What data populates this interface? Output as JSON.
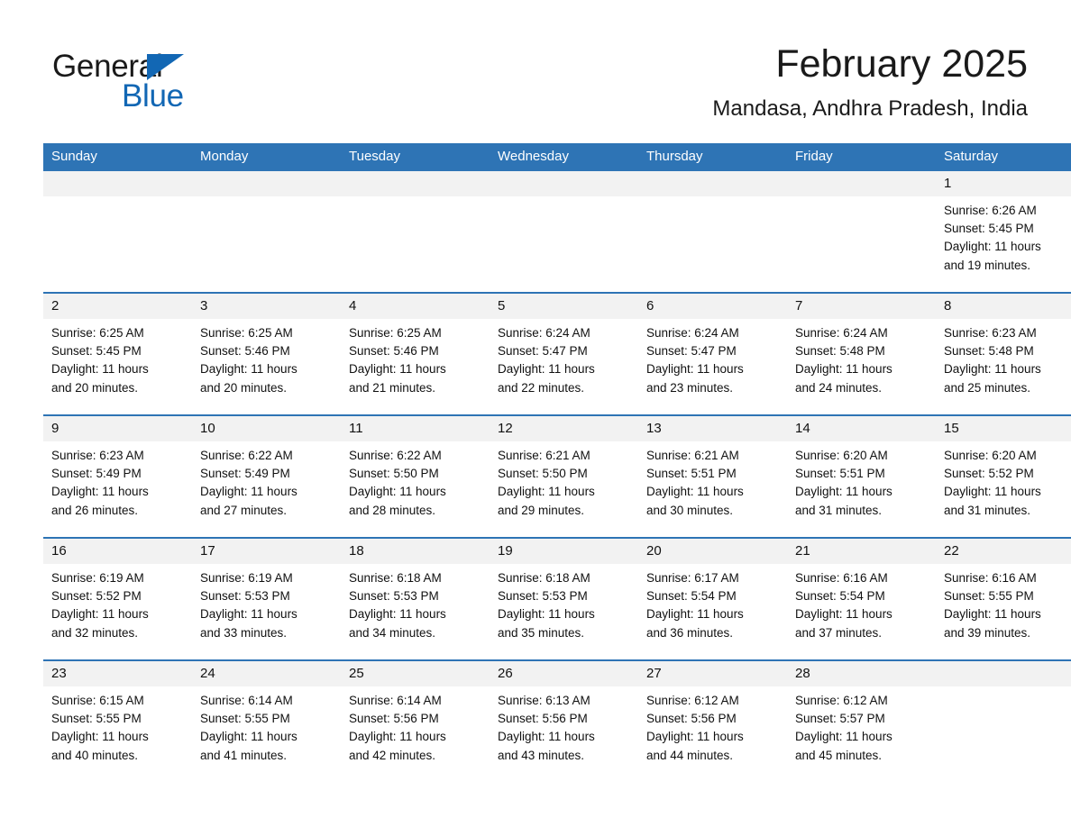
{
  "brand": {
    "name_part1": "General",
    "name_part2": "Blue",
    "accent_color": "#1267b4"
  },
  "header": {
    "title": "February 2025",
    "subtitle": "Mandasa, Andhra Pradesh, India",
    "header_bg_color": "#2e74b5",
    "daynum_bg_color": "#f2f2f2"
  },
  "weekday_headers": [
    "Sunday",
    "Monday",
    "Tuesday",
    "Wednesday",
    "Thursday",
    "Friday",
    "Saturday"
  ],
  "labels": {
    "sunrise_prefix": "Sunrise: ",
    "sunset_prefix": "Sunset: ",
    "daylight_prefix": "Daylight: "
  },
  "weeks": [
    [
      {
        "day": "",
        "blank": true
      },
      {
        "day": "",
        "blank": true
      },
      {
        "day": "",
        "blank": true
      },
      {
        "day": "",
        "blank": true
      },
      {
        "day": "",
        "blank": true
      },
      {
        "day": "",
        "blank": true
      },
      {
        "day": "1",
        "sunrise": "Sunrise: 6:26 AM",
        "sunset": "Sunset: 5:45 PM",
        "daylight_line1": "Daylight: 11 hours",
        "daylight_line2": "and 19 minutes."
      }
    ],
    [
      {
        "day": "2",
        "sunrise": "Sunrise: 6:25 AM",
        "sunset": "Sunset: 5:45 PM",
        "daylight_line1": "Daylight: 11 hours",
        "daylight_line2": "and 20 minutes."
      },
      {
        "day": "3",
        "sunrise": "Sunrise: 6:25 AM",
        "sunset": "Sunset: 5:46 PM",
        "daylight_line1": "Daylight: 11 hours",
        "daylight_line2": "and 20 minutes."
      },
      {
        "day": "4",
        "sunrise": "Sunrise: 6:25 AM",
        "sunset": "Sunset: 5:46 PM",
        "daylight_line1": "Daylight: 11 hours",
        "daylight_line2": "and 21 minutes."
      },
      {
        "day": "5",
        "sunrise": "Sunrise: 6:24 AM",
        "sunset": "Sunset: 5:47 PM",
        "daylight_line1": "Daylight: 11 hours",
        "daylight_line2": "and 22 minutes."
      },
      {
        "day": "6",
        "sunrise": "Sunrise: 6:24 AM",
        "sunset": "Sunset: 5:47 PM",
        "daylight_line1": "Daylight: 11 hours",
        "daylight_line2": "and 23 minutes."
      },
      {
        "day": "7",
        "sunrise": "Sunrise: 6:24 AM",
        "sunset": "Sunset: 5:48 PM",
        "daylight_line1": "Daylight: 11 hours",
        "daylight_line2": "and 24 minutes."
      },
      {
        "day": "8",
        "sunrise": "Sunrise: 6:23 AM",
        "sunset": "Sunset: 5:48 PM",
        "daylight_line1": "Daylight: 11 hours",
        "daylight_line2": "and 25 minutes."
      }
    ],
    [
      {
        "day": "9",
        "sunrise": "Sunrise: 6:23 AM",
        "sunset": "Sunset: 5:49 PM",
        "daylight_line1": "Daylight: 11 hours",
        "daylight_line2": "and 26 minutes."
      },
      {
        "day": "10",
        "sunrise": "Sunrise: 6:22 AM",
        "sunset": "Sunset: 5:49 PM",
        "daylight_line1": "Daylight: 11 hours",
        "daylight_line2": "and 27 minutes."
      },
      {
        "day": "11",
        "sunrise": "Sunrise: 6:22 AM",
        "sunset": "Sunset: 5:50 PM",
        "daylight_line1": "Daylight: 11 hours",
        "daylight_line2": "and 28 minutes."
      },
      {
        "day": "12",
        "sunrise": "Sunrise: 6:21 AM",
        "sunset": "Sunset: 5:50 PM",
        "daylight_line1": "Daylight: 11 hours",
        "daylight_line2": "and 29 minutes."
      },
      {
        "day": "13",
        "sunrise": "Sunrise: 6:21 AM",
        "sunset": "Sunset: 5:51 PM",
        "daylight_line1": "Daylight: 11 hours",
        "daylight_line2": "and 30 minutes."
      },
      {
        "day": "14",
        "sunrise": "Sunrise: 6:20 AM",
        "sunset": "Sunset: 5:51 PM",
        "daylight_line1": "Daylight: 11 hours",
        "daylight_line2": "and 31 minutes."
      },
      {
        "day": "15",
        "sunrise": "Sunrise: 6:20 AM",
        "sunset": "Sunset: 5:52 PM",
        "daylight_line1": "Daylight: 11 hours",
        "daylight_line2": "and 31 minutes."
      }
    ],
    [
      {
        "day": "16",
        "sunrise": "Sunrise: 6:19 AM",
        "sunset": "Sunset: 5:52 PM",
        "daylight_line1": "Daylight: 11 hours",
        "daylight_line2": "and 32 minutes."
      },
      {
        "day": "17",
        "sunrise": "Sunrise: 6:19 AM",
        "sunset": "Sunset: 5:53 PM",
        "daylight_line1": "Daylight: 11 hours",
        "daylight_line2": "and 33 minutes."
      },
      {
        "day": "18",
        "sunrise": "Sunrise: 6:18 AM",
        "sunset": "Sunset: 5:53 PM",
        "daylight_line1": "Daylight: 11 hours",
        "daylight_line2": "and 34 minutes."
      },
      {
        "day": "19",
        "sunrise": "Sunrise: 6:18 AM",
        "sunset": "Sunset: 5:53 PM",
        "daylight_line1": "Daylight: 11 hours",
        "daylight_line2": "and 35 minutes."
      },
      {
        "day": "20",
        "sunrise": "Sunrise: 6:17 AM",
        "sunset": "Sunset: 5:54 PM",
        "daylight_line1": "Daylight: 11 hours",
        "daylight_line2": "and 36 minutes."
      },
      {
        "day": "21",
        "sunrise": "Sunrise: 6:16 AM",
        "sunset": "Sunset: 5:54 PM",
        "daylight_line1": "Daylight: 11 hours",
        "daylight_line2": "and 37 minutes."
      },
      {
        "day": "22",
        "sunrise": "Sunrise: 6:16 AM",
        "sunset": "Sunset: 5:55 PM",
        "daylight_line1": "Daylight: 11 hours",
        "daylight_line2": "and 39 minutes."
      }
    ],
    [
      {
        "day": "23",
        "sunrise": "Sunrise: 6:15 AM",
        "sunset": "Sunset: 5:55 PM",
        "daylight_line1": "Daylight: 11 hours",
        "daylight_line2": "and 40 minutes."
      },
      {
        "day": "24",
        "sunrise": "Sunrise: 6:14 AM",
        "sunset": "Sunset: 5:55 PM",
        "daylight_line1": "Daylight: 11 hours",
        "daylight_line2": "and 41 minutes."
      },
      {
        "day": "25",
        "sunrise": "Sunrise: 6:14 AM",
        "sunset": "Sunset: 5:56 PM",
        "daylight_line1": "Daylight: 11 hours",
        "daylight_line2": "and 42 minutes."
      },
      {
        "day": "26",
        "sunrise": "Sunrise: 6:13 AM",
        "sunset": "Sunset: 5:56 PM",
        "daylight_line1": "Daylight: 11 hours",
        "daylight_line2": "and 43 minutes."
      },
      {
        "day": "27",
        "sunrise": "Sunrise: 6:12 AM",
        "sunset": "Sunset: 5:56 PM",
        "daylight_line1": "Daylight: 11 hours",
        "daylight_line2": "and 44 minutes."
      },
      {
        "day": "28",
        "sunrise": "Sunrise: 6:12 AM",
        "sunset": "Sunset: 5:57 PM",
        "daylight_line1": "Daylight: 11 hours",
        "daylight_line2": "and 45 minutes."
      },
      {
        "day": "",
        "blank": true
      }
    ]
  ]
}
